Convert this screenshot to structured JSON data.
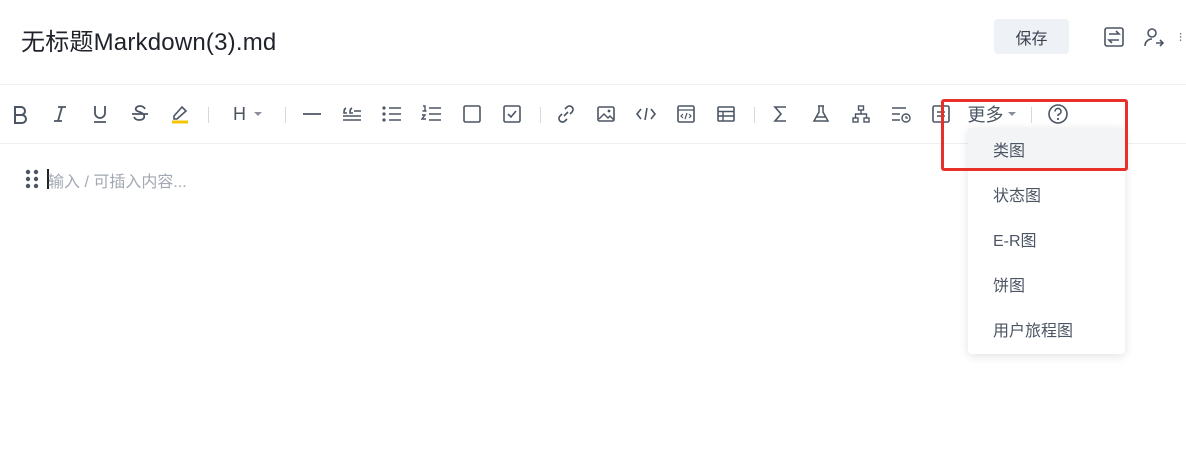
{
  "header": {
    "title": "无标题Markdown(3).md",
    "save_label": "保存",
    "icons": [
      "switch-icon",
      "share-user-icon",
      "more-vertical-icon"
    ]
  },
  "toolbar": {
    "buttons": [
      "bold",
      "italic",
      "underline",
      "strikethrough",
      "highlight",
      "heading",
      "horizontal-rule",
      "quote",
      "bullet-list",
      "ordered-list",
      "checkbox",
      "checked-checkbox",
      "link",
      "image",
      "inline-code",
      "code-block",
      "table",
      "formula",
      "flask",
      "org-chart",
      "insert-block",
      "callout"
    ],
    "heading_label": "H",
    "more_label": "更多",
    "help_icon": "help-icon"
  },
  "editor": {
    "placeholder": "输入 / 可插入内容..."
  },
  "dropdown": {
    "items": [
      {
        "label": "类图",
        "active": true
      },
      {
        "label": "状态图",
        "active": false
      },
      {
        "label": "E-R图",
        "active": false
      },
      {
        "label": "饼图",
        "active": false
      },
      {
        "label": "用户旅程图",
        "active": false
      }
    ]
  },
  "colors": {
    "highlight_border": "#e8302a",
    "highlight_underline": "#f5c400",
    "icon": "#4b5563"
  }
}
